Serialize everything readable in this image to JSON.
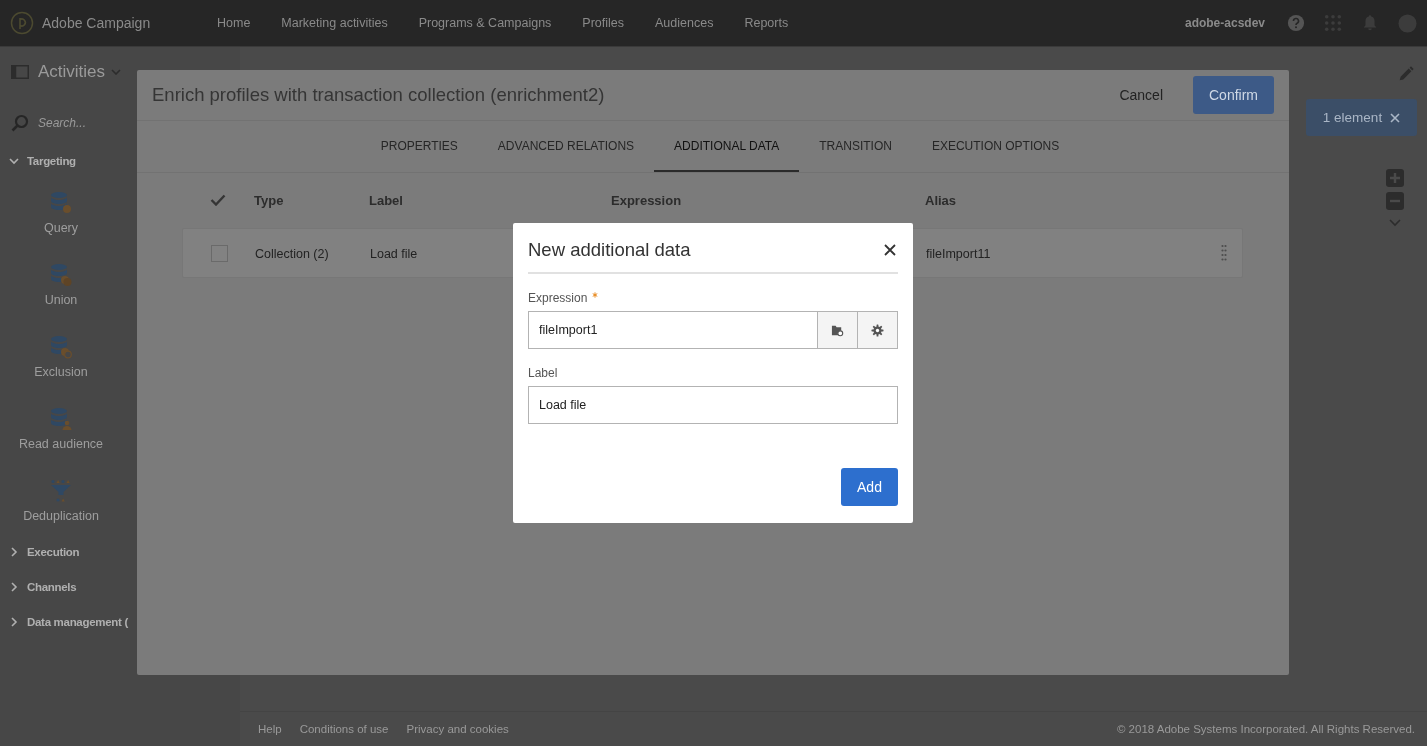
{
  "topbar": {
    "brand": "Adobe Campaign",
    "nav": [
      "Home",
      "Marketing activities",
      "Programs & Campaigns",
      "Profiles",
      "Audiences",
      "Reports"
    ],
    "user": "adobe-acsdev"
  },
  "sidebar": {
    "title": "Activities",
    "search_placeholder": "Search...",
    "sections": [
      {
        "label": "Targeting",
        "expanded": true,
        "items": [
          "Query",
          "Union",
          "Exclusion",
          "Read audience",
          "Deduplication"
        ]
      },
      {
        "label": "Execution",
        "expanded": false
      },
      {
        "label": "Channels",
        "expanded": false
      },
      {
        "label": "Data management (",
        "expanded": false
      }
    ]
  },
  "canvas": {
    "selection_badge": "1 element"
  },
  "footer": {
    "links": [
      "Help",
      "Conditions of use",
      "Privacy and cookies"
    ],
    "copyright": "© 2018 Adobe Systems Incorporated. All Rights Reserved."
  },
  "dialog": {
    "title": "Enrich profiles with transaction collection (enrichment2)",
    "cancel": "Cancel",
    "confirm": "Confirm",
    "tabs": [
      {
        "label": "PROPERTIES",
        "selected": false
      },
      {
        "label": "ADVANCED RELATIONS",
        "selected": false
      },
      {
        "label": "ADDITIONAL DATA",
        "selected": true
      },
      {
        "label": "TRANSITION",
        "selected": false
      },
      {
        "label": "EXECUTION OPTIONS",
        "selected": false
      }
    ],
    "table": {
      "columns": [
        "Type",
        "Label",
        "Expression",
        "Alias"
      ],
      "rows": [
        {
          "checked": false,
          "type": "Collection (2)",
          "label": "Load file",
          "alias": "fileImport11"
        }
      ]
    }
  },
  "modal": {
    "title": "New additional data",
    "fields": [
      {
        "kind": "expression",
        "label": "Expression",
        "required": true,
        "value": "fileImport1"
      },
      {
        "kind": "text",
        "label": "Label",
        "required": false,
        "value": "Load file"
      }
    ],
    "add": "Add"
  }
}
